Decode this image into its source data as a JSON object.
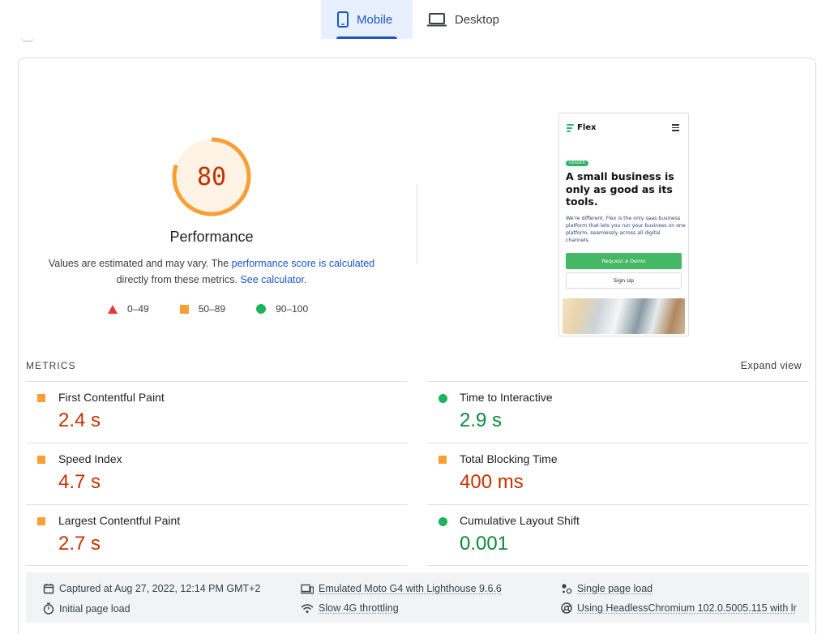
{
  "tabs": [
    {
      "label": "Mobile",
      "active": true,
      "icon": "smartphone-icon"
    },
    {
      "label": "Desktop",
      "active": false,
      "icon": "laptop-icon"
    }
  ],
  "colors": {
    "accent": "#1a56c8",
    "score_fail": "#e53935",
    "score_average": "#fa9e35",
    "score_pass": "#1bb35b",
    "value_average": "#c33300",
    "value_pass": "#0b8a38"
  },
  "performance": {
    "score": "80",
    "score_fraction": 0.8,
    "title": "Performance",
    "desc_prefix": "Values are estimated and may vary. The ",
    "desc_link1": "performance score is calculated",
    "desc_middle": "directly from these metrics. ",
    "desc_link2": "See calculator."
  },
  "legend": [
    {
      "label": "0–49",
      "shape": "triangle"
    },
    {
      "label": "50–89",
      "shape": "square"
    },
    {
      "label": "90–100",
      "shape": "circle"
    }
  ],
  "screenshot": {
    "brand": "Flex",
    "badge": "HEADER",
    "heading": "A small business is only as good as its tools.",
    "paragraph": "We're different. Flex is the only saas business platform that lets you run your business on one platform, seamlessly across all digital channels.",
    "primary_button": "Request a Demo",
    "secondary_button": "Sign Up"
  },
  "metrics_section": {
    "label": "METRICS",
    "expand_label": "Expand view"
  },
  "metrics": [
    {
      "name": "First Contentful Paint",
      "value": "2.4 s",
      "rating": "average"
    },
    {
      "name": "Time to Interactive",
      "value": "2.9 s",
      "rating": "pass"
    },
    {
      "name": "Speed Index",
      "value": "4.7 s",
      "rating": "average"
    },
    {
      "name": "Total Blocking Time",
      "value": "400 ms",
      "rating": "average"
    },
    {
      "name": "Largest Contentful Paint",
      "value": "2.7 s",
      "rating": "average"
    },
    {
      "name": "Cumulative Layout Shift",
      "value": "0.001",
      "rating": "pass"
    }
  ],
  "runtime": {
    "captured": "Captured at Aug 27, 2022, 12:14 PM GMT+2",
    "device": "Emulated Moto G4 with Lighthouse 9.6.6",
    "session": "Single page load",
    "load": "Initial page load",
    "throttling": "Slow 4G throttling",
    "browser": "Using HeadlessChromium 102.0.5005.115 with lr"
  }
}
